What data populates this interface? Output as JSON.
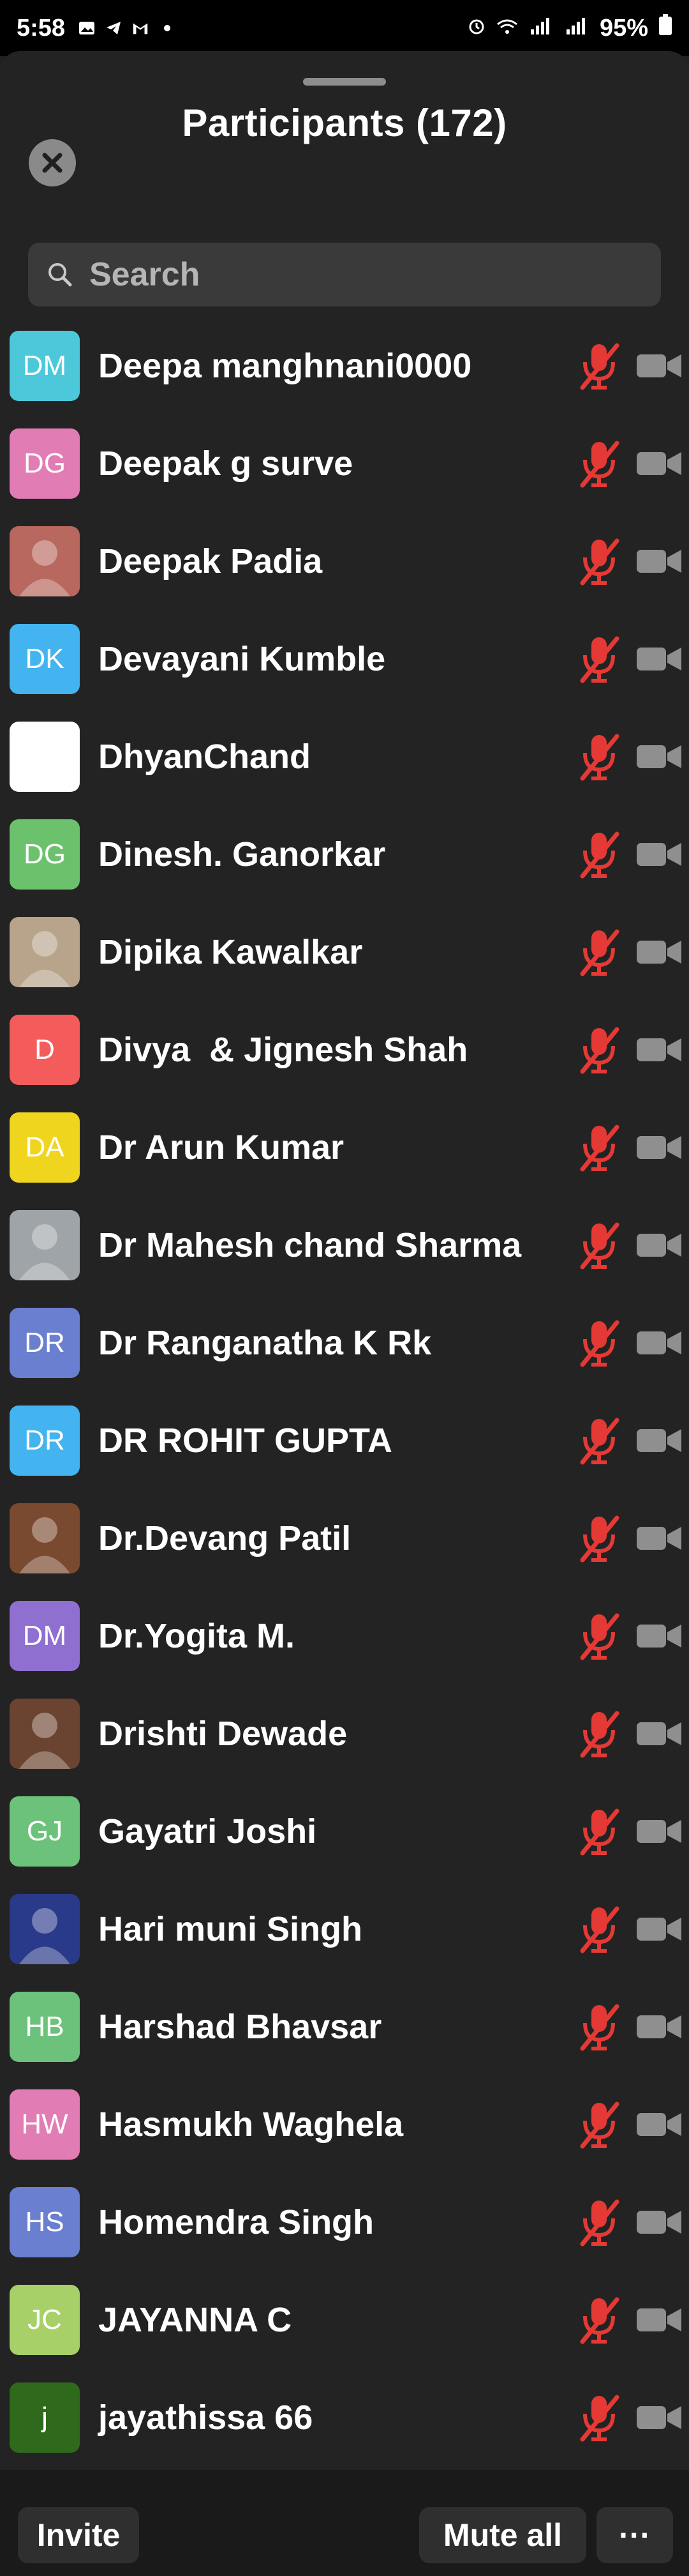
{
  "status_bar": {
    "time": "5:58",
    "battery": "95%"
  },
  "header": {
    "title": "Participants (172)"
  },
  "search": {
    "placeholder": "Search"
  },
  "participants": [
    {
      "name": "Deepa manghnani0000",
      "initials": "DM",
      "color": "#4dc8da",
      "photo": false
    },
    {
      "name": "Deepak g surve",
      "initials": "DG",
      "color": "#e27cb4",
      "photo": false
    },
    {
      "name": "Deepak Padia",
      "initials": "",
      "color": "#b8685e",
      "photo": true
    },
    {
      "name": "Devayani Kumble",
      "initials": "DK",
      "color": "#43b4f0",
      "photo": false
    },
    {
      "name": "DhyanChand",
      "initials": "",
      "color": "#ffffff",
      "photo": true
    },
    {
      "name": "Dinesh. Ganorkar",
      "initials": "DG",
      "color": "#6cc26c",
      "photo": false
    },
    {
      "name": "Dipika Kawalkar",
      "initials": "",
      "color": "#b7a48a",
      "photo": true
    },
    {
      "name": "Divya  & Jignesh Shah",
      "initials": "D",
      "color": "#f45c5c",
      "photo": false
    },
    {
      "name": "Dr Arun Kumar",
      "initials": "DA",
      "color": "#f0d51f",
      "photo": false
    },
    {
      "name": "Dr Mahesh chand Sharma",
      "initials": "",
      "color": "#9fa4a8",
      "photo": true
    },
    {
      "name": "Dr Ranganatha K Rk",
      "initials": "DR",
      "color": "#6a7fd0",
      "photo": false
    },
    {
      "name": "DR ROHIT GUPTA",
      "initials": "DR",
      "color": "#43b4f0",
      "photo": false
    },
    {
      "name": "Dr.Devang Patil",
      "initials": "",
      "color": "#7a4a30",
      "photo": true
    },
    {
      "name": "Dr.Yogita M.",
      "initials": "DM",
      "color": "#8f6fd0",
      "photo": false
    },
    {
      "name": "Drishti Dewade",
      "initials": "",
      "color": "#6a4430",
      "photo": true
    },
    {
      "name": "Gayatri Joshi",
      "initials": "GJ",
      "color": "#6cc27a",
      "photo": false
    },
    {
      "name": "Hari muni Singh",
      "initials": "",
      "color": "#2a3a8a",
      "photo": true
    },
    {
      "name": "Harshad Bhavsar",
      "initials": "HB",
      "color": "#6cc27a",
      "photo": false
    },
    {
      "name": "Hasmukh Waghela",
      "initials": "HW",
      "color": "#e27cb4",
      "photo": false
    },
    {
      "name": "Homendra Singh",
      "initials": "HS",
      "color": "#6a7fd0",
      "photo": false
    },
    {
      "name": "JAYANNA C",
      "initials": "JC",
      "color": "#a8d068",
      "photo": false
    },
    {
      "name": "jayathissa 66",
      "initials": "j",
      "color": "#2f6a1c",
      "photo": false
    }
  ],
  "icons": {
    "mic": "mic-muted-icon",
    "camera": "video-off-icon"
  },
  "footer": {
    "invite_label": "Invite",
    "mute_all_label": "Mute all",
    "more_label": "···"
  }
}
